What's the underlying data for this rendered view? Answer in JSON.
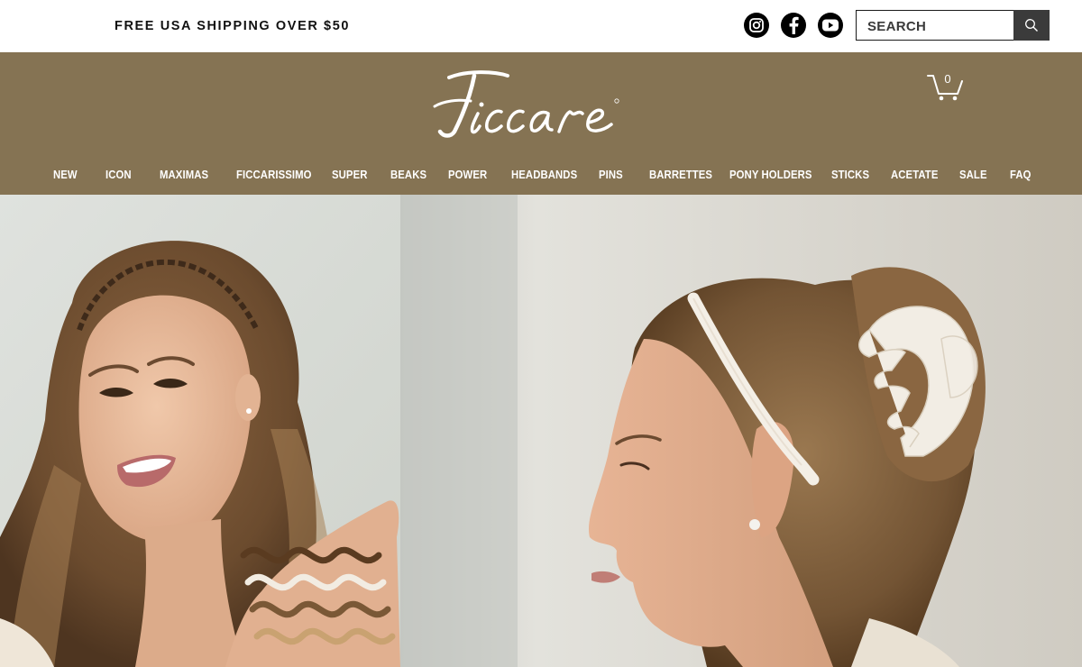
{
  "topbar": {
    "promo_text": "FREE USA SHIPPING OVER $50",
    "social": [
      "instagram-icon",
      "facebook-icon",
      "youtube-icon"
    ],
    "search": {
      "placeholder": "SEARCH",
      "value": ""
    }
  },
  "header": {
    "logo_text": "Ficcare",
    "cart_count": "0",
    "background_color": "#857353"
  },
  "nav": {
    "items": [
      {
        "label": "NEW"
      },
      {
        "label": "ICON"
      },
      {
        "label": "MAXIMAS"
      },
      {
        "label": "FICCARISSIMO"
      },
      {
        "label": "SUPER"
      },
      {
        "label": "BEAKS"
      },
      {
        "label": "POWER"
      },
      {
        "label": "HEADBANDS"
      },
      {
        "label": "PINS"
      },
      {
        "label": "BARRETTES"
      },
      {
        "label": "PONY HOLDERS"
      },
      {
        "label": "STICKS"
      },
      {
        "label": "ACETATE"
      },
      {
        "label": "SALE"
      },
      {
        "label": "FAQ"
      }
    ]
  },
  "hero": {
    "images": [
      {
        "name": "woman-with-tortoise-wavy-headbands"
      },
      {
        "name": "woman-with-cream-headband-and-claw-clip"
      }
    ]
  }
}
